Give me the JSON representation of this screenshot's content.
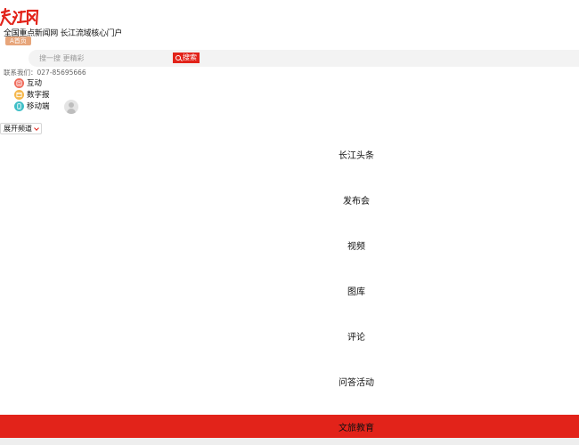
{
  "brand": {
    "slogan": "全国重点新闻网 长江流域核心门户",
    "home_badge": "A首页",
    "logo_color": "#e2231a"
  },
  "search": {
    "placeholder": "搜一搜 更精彩",
    "button_label": "搜索",
    "button_icon": "search-icon"
  },
  "contact": {
    "text": "联系我们：027-85695666"
  },
  "quick_links": [
    {
      "label": "互动",
      "icon": "interact-icon",
      "color": "#ef6b5c"
    },
    {
      "label": "数字报",
      "icon": "newspaper-icon",
      "color": "#f5b74b"
    },
    {
      "label": "移动端",
      "icon": "mobile-icon",
      "color": "#3fbfc7"
    }
  ],
  "user": {
    "avatar_icon": "user-avatar-icon"
  },
  "channel_toggle": {
    "label": "展开频道",
    "icon": "chevron-down-icon"
  },
  "channels": [
    {
      "label": "长江头条"
    },
    {
      "label": "发布会"
    },
    {
      "label": "视频"
    },
    {
      "label": "图库"
    },
    {
      "label": "评论"
    },
    {
      "label": "问答活动"
    },
    {
      "label": "文旅教育"
    }
  ],
  "colors": {
    "accent": "#e2231a"
  }
}
